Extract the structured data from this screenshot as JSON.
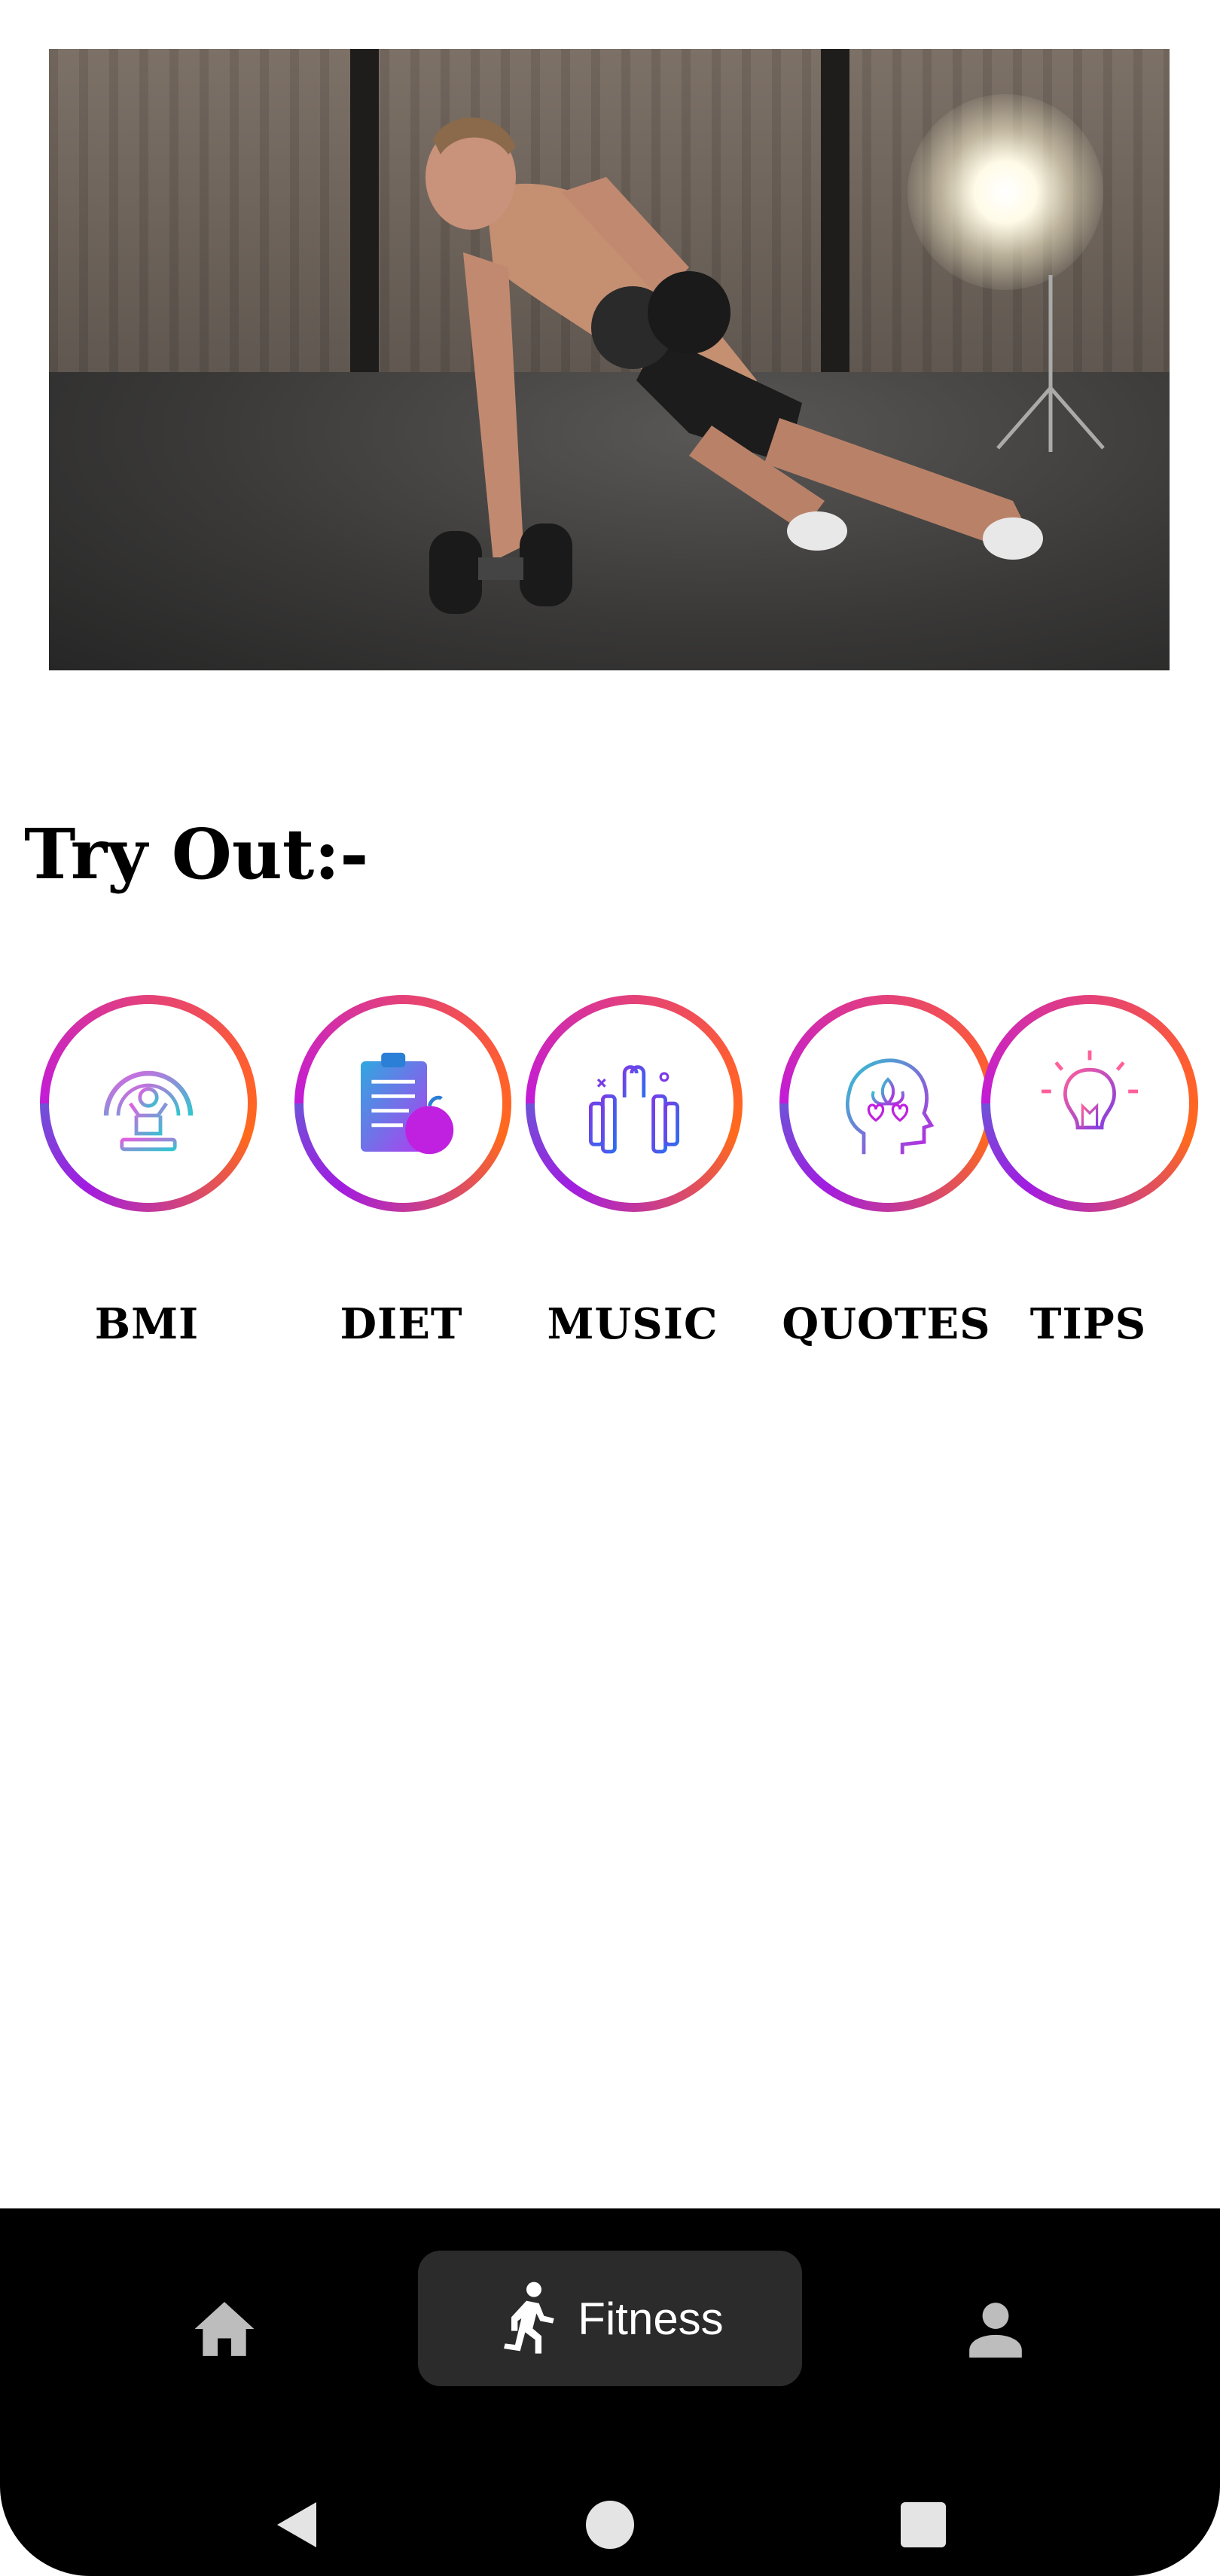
{
  "hero": {
    "image": "man doing renegade row push-up with dumbbells in a warehouse"
  },
  "section": {
    "title": "Try Out:-"
  },
  "features": [
    {
      "label": "BMI",
      "icon": "bmi-meter-icon"
    },
    {
      "label": "DIET",
      "icon": "clipboard-apple-icon"
    },
    {
      "label": "MUSIC",
      "icon": "dumbbell-earbuds-icon"
    },
    {
      "label": "QUOTES",
      "icon": "head-lotus-icon"
    },
    {
      "label": "TIPS",
      "icon": "light-bulb-icon"
    }
  ],
  "bottom_nav": {
    "home_icon": "home-icon",
    "active_label": "Fitness",
    "active_icon": "running-person-icon",
    "profile_icon": "person-icon"
  },
  "system_nav": {
    "back_icon": "back-triangle-icon",
    "home_icon": "home-circle-icon",
    "recents_icon": "recents-square-icon"
  },
  "colors": {
    "ring_start": "#c21bd8",
    "ring_end": "#ff6a1c",
    "nav_background": "#000000",
    "nav_active_pill": "#2b2b2b"
  }
}
